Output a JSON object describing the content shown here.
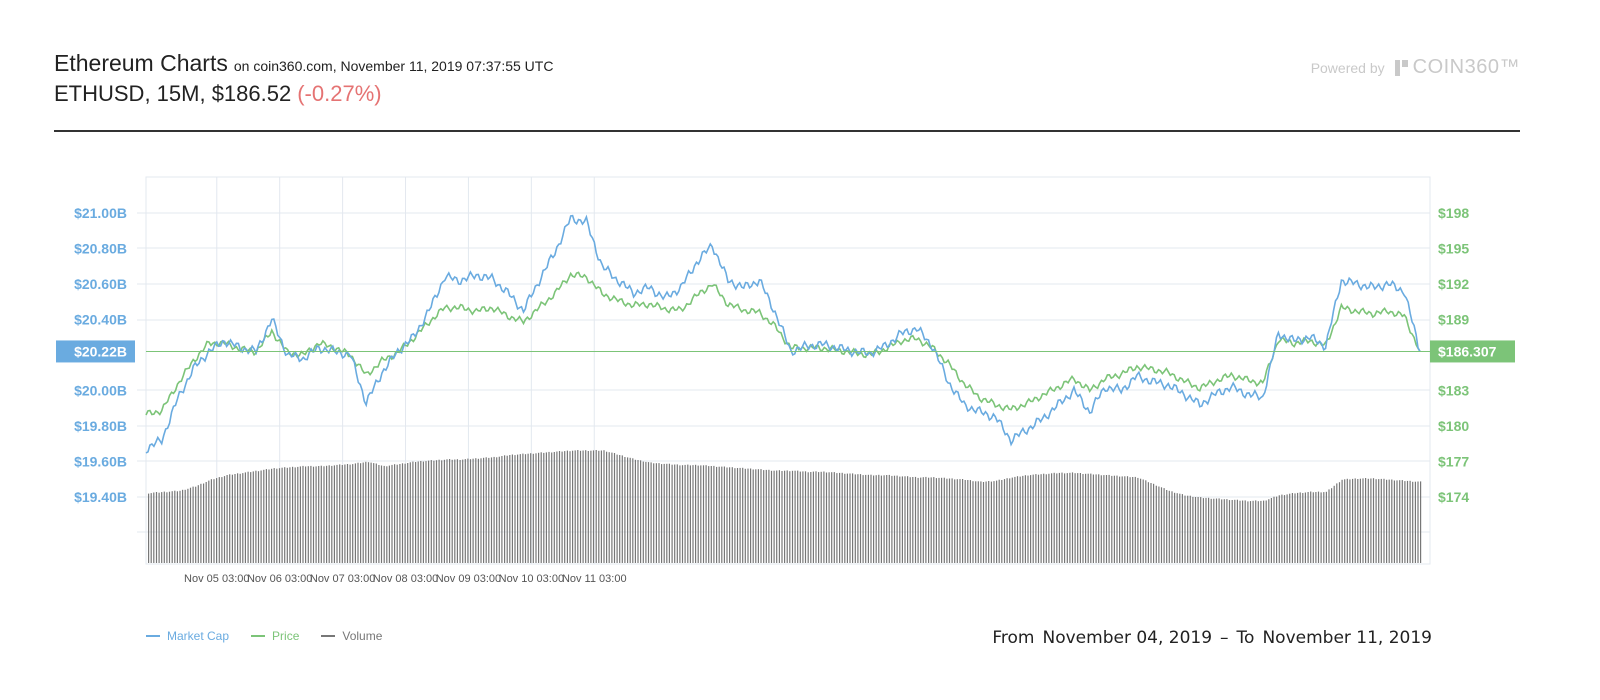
{
  "header": {
    "title": "Ethereum Charts",
    "subtitle": "on coin360.com, November 11, 2019 07:37:55 UTC",
    "ticker": "ETHUSD, 15M, $186.52",
    "change": "(-0.27%)",
    "change_color": "#e57373"
  },
  "branding": {
    "powered_by": "Powered by",
    "brand_name": "COIN360™",
    "icon": "coin360-logo-icon"
  },
  "range": {
    "from_label": "From",
    "from_date": "November 04, 2019",
    "separator": "–",
    "to_label": "To",
    "to_date": "November 11, 2019"
  },
  "colors": {
    "market_cap": "#6aabe0",
    "price": "#7cc478",
    "volume": "#777777",
    "grid": "#e3e8ef"
  },
  "chart_data": {
    "type": "line",
    "x_ticks": [
      "Nov 05 03:00",
      "Nov 06 03:00",
      "Nov 07 03:00",
      "Nov 08 03:00",
      "Nov 09 03:00",
      "Nov 10 03:00",
      "Nov 11 03:00"
    ],
    "x_start_hour": -21,
    "x_step_hours": 6,
    "y_left_ticks": [
      "$21.00B",
      "$20.80B",
      "$20.60B",
      "$20.40B",
      "$20.22B",
      "$20.00B",
      "$19.80B",
      "$19.60B",
      "$19.40B"
    ],
    "y_left_ticks_values": [
      21.0,
      20.8,
      20.6,
      20.4,
      20.2,
      20.0,
      19.8,
      19.6,
      19.4
    ],
    "y_right_ticks": [
      "$198",
      "$195",
      "$192",
      "$189",
      "$186.307",
      "$183",
      "$180",
      "$177",
      "$174"
    ],
    "y_right_ticks_values": [
      198,
      195,
      192,
      189,
      186,
      183,
      180,
      177,
      174
    ],
    "current_left_label": "$20.22B",
    "current_left_value": 20.22,
    "current_right_label": "$186.307",
    "current_right_value": 186.307,
    "legend": [
      "Market Cap",
      "Price",
      "Volume"
    ],
    "series": [
      {
        "name": "Market Cap",
        "axis": "left",
        "unit": "B USD",
        "values": [
          19.67,
          19.72,
          19.95,
          20.12,
          20.22,
          20.28,
          20.24,
          20.22,
          20.4,
          20.2,
          20.18,
          20.24,
          20.22,
          20.2,
          19.93,
          20.1,
          20.22,
          20.3,
          20.45,
          20.64,
          20.62,
          20.65,
          20.63,
          20.55,
          20.45,
          20.62,
          20.78,
          20.97,
          20.95,
          20.7,
          20.62,
          20.55,
          20.58,
          20.52,
          20.58,
          20.72,
          20.82,
          20.62,
          20.58,
          20.62,
          20.44,
          20.22,
          20.25,
          20.26,
          20.24,
          20.22,
          20.21,
          20.25,
          20.32,
          20.35,
          20.25,
          20.05,
          19.92,
          19.88,
          19.85,
          19.72,
          19.78,
          19.84,
          19.92,
          20.0,
          19.88,
          20.02,
          20.0,
          20.08,
          20.05,
          20.03,
          19.98,
          19.92,
          19.98,
          20.02,
          19.98,
          19.96,
          20.32,
          20.28,
          20.3,
          20.25,
          20.62,
          20.6,
          20.58,
          20.6,
          20.56,
          20.22
        ]
      },
      {
        "name": "Price",
        "axis": "right",
        "unit": "USD",
        "values": [
          181.0,
          181.3,
          183.5,
          185.5,
          187.0,
          187.0,
          186.5,
          186.3,
          188.0,
          186.2,
          186.0,
          187.0,
          186.6,
          186.0,
          184.3,
          185.5,
          186.2,
          187.4,
          188.8,
          190.0,
          190.0,
          189.7,
          190.0,
          189.3,
          188.8,
          190.0,
          191.2,
          192.8,
          192.6,
          191.2,
          190.6,
          190.2,
          190.3,
          189.9,
          189.8,
          191.0,
          192.0,
          190.3,
          189.8,
          189.6,
          188.4,
          186.6,
          186.6,
          186.6,
          186.4,
          186.2,
          186.0,
          186.5,
          187.2,
          187.4,
          186.6,
          185.3,
          183.6,
          182.4,
          181.8,
          181.4,
          181.9,
          182.6,
          183.3,
          184.0,
          183.0,
          184.0,
          184.4,
          185.0,
          184.8,
          184.5,
          183.8,
          183.2,
          183.8,
          184.3,
          183.9,
          183.6,
          187.3,
          187.0,
          187.2,
          186.8,
          190.0,
          189.7,
          189.5,
          189.7,
          189.3,
          186.3
        ]
      },
      {
        "name": "Volume",
        "axis": "bottom",
        "unit": "relative",
        "values": [
          0.62,
          0.63,
          0.64,
          0.68,
          0.74,
          0.78,
          0.8,
          0.82,
          0.84,
          0.85,
          0.86,
          0.86,
          0.87,
          0.88,
          0.9,
          0.86,
          0.88,
          0.9,
          0.91,
          0.92,
          0.92,
          0.93,
          0.94,
          0.96,
          0.97,
          0.98,
          0.99,
          1.0,
          1.0,
          1.0,
          0.96,
          0.92,
          0.89,
          0.88,
          0.87,
          0.87,
          0.86,
          0.85,
          0.84,
          0.83,
          0.82,
          0.82,
          0.81,
          0.81,
          0.8,
          0.79,
          0.78,
          0.78,
          0.77,
          0.76,
          0.76,
          0.75,
          0.74,
          0.72,
          0.73,
          0.76,
          0.78,
          0.79,
          0.8,
          0.8,
          0.79,
          0.78,
          0.77,
          0.76,
          0.7,
          0.64,
          0.6,
          0.58,
          0.57,
          0.56,
          0.55,
          0.55,
          0.6,
          0.62,
          0.63,
          0.63,
          0.74,
          0.75,
          0.75,
          0.74,
          0.73,
          0.72
        ]
      }
    ],
    "grid": true,
    "legend_position": "bottom-left"
  }
}
